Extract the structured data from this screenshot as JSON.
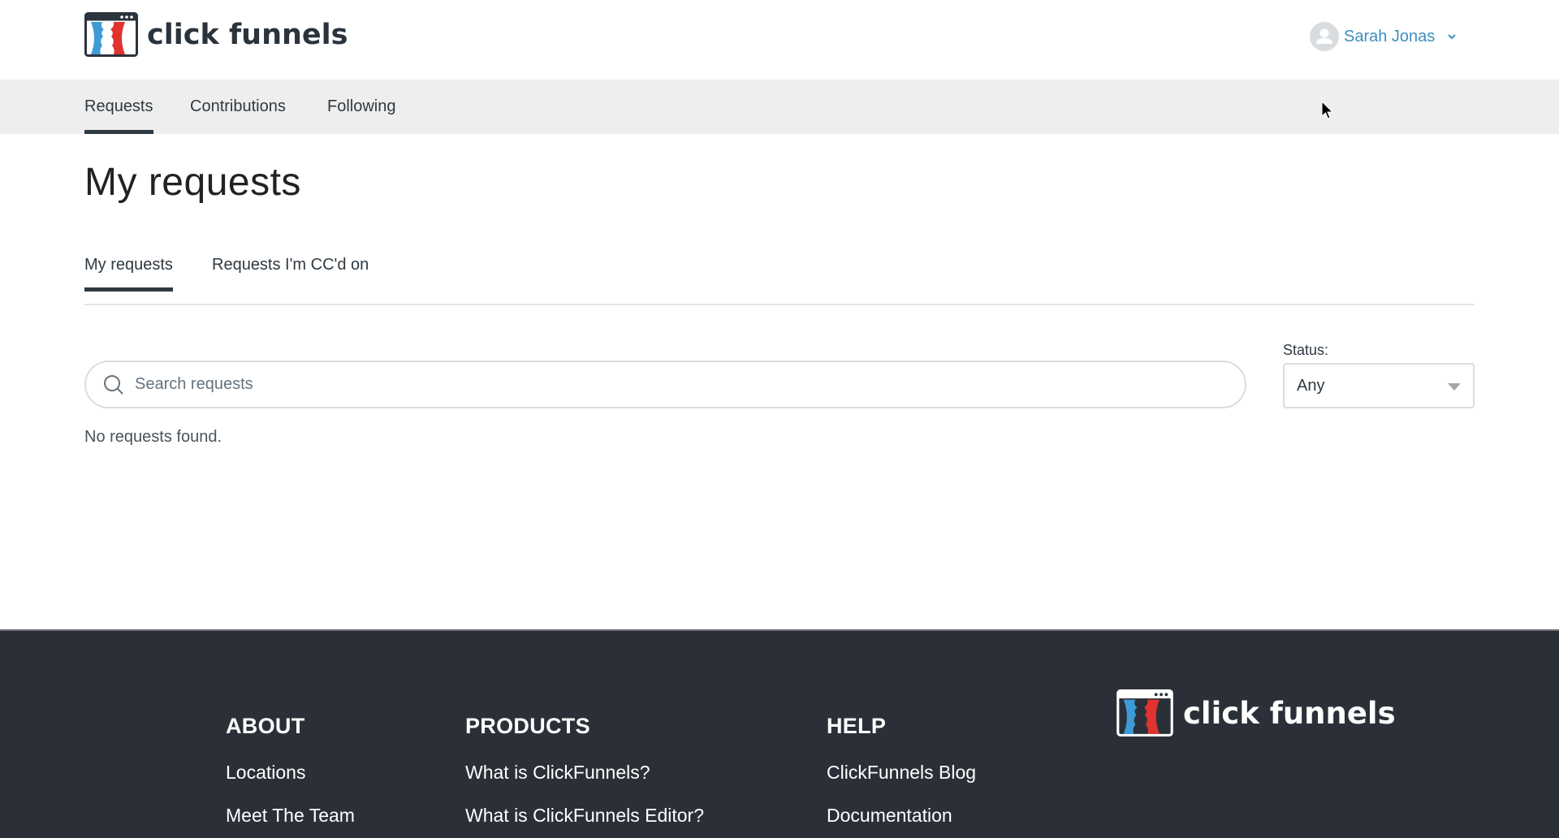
{
  "header": {
    "logo_text": "click funnels",
    "user_name": "Sarah Jonas"
  },
  "nav": {
    "items": [
      {
        "label": "Requests",
        "active": true
      },
      {
        "label": "Contributions",
        "active": false
      },
      {
        "label": "Following",
        "active": false
      }
    ]
  },
  "main": {
    "title": "My requests",
    "subtabs": [
      {
        "label": "My requests",
        "active": true
      },
      {
        "label": "Requests I'm CC'd on",
        "active": false
      }
    ],
    "search": {
      "placeholder": "Search requests",
      "value": ""
    },
    "status": {
      "label": "Status:",
      "selected": "Any"
    },
    "empty_message": "No requests found."
  },
  "footer": {
    "columns": [
      {
        "heading": "ABOUT",
        "links": [
          "Locations",
          "Meet The Team"
        ]
      },
      {
        "heading": "PRODUCTS",
        "links": [
          "What is ClickFunnels?",
          "What is ClickFunnels Editor?"
        ]
      },
      {
        "heading": "HELP",
        "links": [
          "ClickFunnels Blog",
          "Documentation"
        ]
      }
    ],
    "logo_text": "click funnels"
  },
  "colors": {
    "brand_dark": "#2b333d",
    "brand_blue": "#3d9bd6",
    "brand_red": "#e0332f",
    "link_user": "#3d8fbf",
    "footer_bg": "#2b3038",
    "nav_bg": "#eeeeee"
  }
}
